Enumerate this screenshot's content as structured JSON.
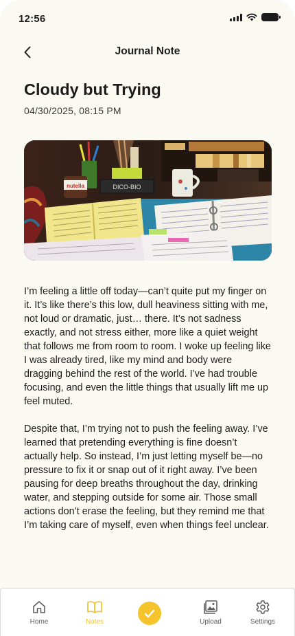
{
  "status_bar": {
    "time": "12:56"
  },
  "header": {
    "title": "Journal Note"
  },
  "note": {
    "title": "Cloudy but Trying",
    "date": "04/30/2025, 08:15 PM",
    "paragraphs": [
      "I’m feeling a little off today—can’t quite put my finger on it. It’s like there’s this low, dull heaviness sitting with me, not loud or dramatic, just… there. It’s not sadness exactly, and not stress either, more like a quiet weight that follows me from room to room. I woke up feeling like I was already tired, like my mind and body were dragging behind the rest of the world. I’ve had trouble focusing, and even the little things that usually lift me up feel muted.",
      "Despite that, I’m trying not to push the feeling away. I’ve learned that pretending everything is fine doesn’t actually help. So instead, I’m just letting myself be—no pressure to fix it or snap out of it right away. I’ve been pausing for deep breaths throughout the day, drinking water, and stepping outside for some air. Those small actions don’t erase the feeling, but they remind me that I’m taking care of myself, even when things feel unclear."
    ]
  },
  "photo": {
    "jar_label": "nutella",
    "box_label": "DICO-BIO"
  },
  "nav": {
    "items": [
      {
        "label": "Home",
        "icon": "home-icon"
      },
      {
        "label": "Notes",
        "icon": "book-icon",
        "active": true
      },
      {
        "label": "Upload",
        "icon": "gallery-icon"
      },
      {
        "label": "Settings",
        "icon": "gear-icon"
      }
    ],
    "center_icon": "check-icon"
  },
  "colors": {
    "background": "#fafaf3",
    "accent": "#f5c42c",
    "active_nav": "#f2c230",
    "text": "#1c1c1c"
  }
}
